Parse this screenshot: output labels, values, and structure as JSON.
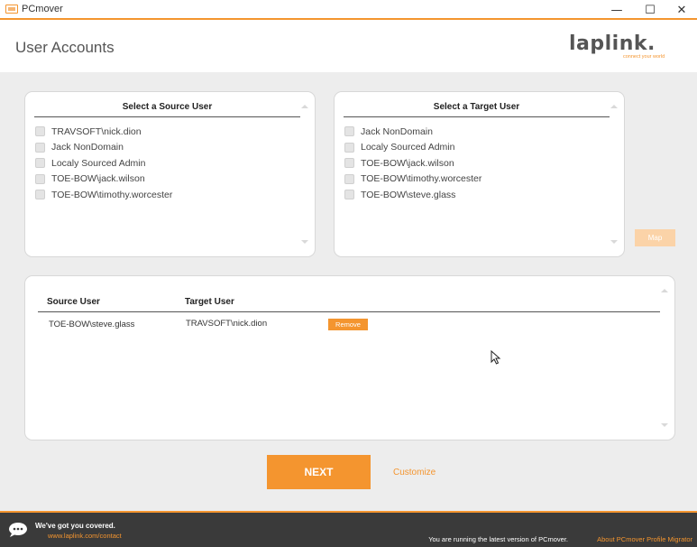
{
  "window": {
    "title": "PCmover",
    "minimize_glyph": "—",
    "maximize_glyph": "☐",
    "close_glyph": "✕"
  },
  "header": {
    "page_title": "User Accounts",
    "logo_text": "laplink.",
    "logo_tagline": "connect your world"
  },
  "source_panel": {
    "title": "Select a Source User",
    "users": [
      "TRAVSOFT\\nick.dion",
      "Jack NonDomain",
      "Localy Sourced Admin",
      "TOE-BOW\\jack.wilson",
      "TOE-BOW\\timothy.worcester"
    ]
  },
  "target_panel": {
    "title": "Select a Target User",
    "users": [
      "Jack NonDomain",
      "Localy Sourced Admin",
      "TOE-BOW\\jack.wilson",
      "TOE-BOW\\timothy.worcester",
      "TOE-BOW\\steve.glass"
    ]
  },
  "map_button_label": "Map",
  "mapping": {
    "col_source": "Source User",
    "col_target": "Target User",
    "rows": [
      {
        "source": "TOE-BOW\\steve.glass",
        "target": "TRAVSOFT\\nick.dion",
        "remove_label": "Remove"
      }
    ]
  },
  "next_label": "NEXT",
  "customize_label": "Customize",
  "footer": {
    "tagline": "We've got you covered.",
    "contact_link": "www.laplink.com/contact",
    "status": "You are running the latest version of PCmover.",
    "about_link": "About PCmover Profile Migrator"
  },
  "colors": {
    "accent": "#f4952f",
    "accent_disabled": "#fbd3a8",
    "footer_bg": "#3a3a3a",
    "main_bg": "#ededed"
  }
}
